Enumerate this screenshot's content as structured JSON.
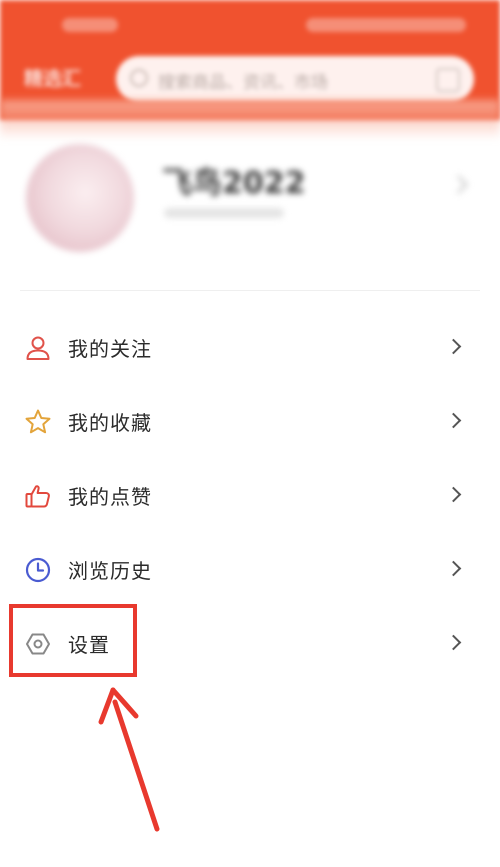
{
  "colors": {
    "header_bg": "#f0522f",
    "annotation_red": "#e8392e",
    "icon_follow": "#e0524a",
    "icon_favorite": "#e3a43a",
    "icon_like": "#e2483d",
    "icon_history": "#4a5bd1",
    "icon_settings": "#888888"
  },
  "header": {
    "title": "精选汇",
    "search_placeholder": "搜索商品、资讯、市场"
  },
  "profile": {
    "username": "飞鸟2022"
  },
  "menu": {
    "items": [
      {
        "label": "我的关注",
        "icon": "user-icon"
      },
      {
        "label": "我的收藏",
        "icon": "star-icon"
      },
      {
        "label": "我的点赞",
        "icon": "thumbs-up-icon"
      },
      {
        "label": "浏览历史",
        "icon": "clock-icon"
      },
      {
        "label": "设置",
        "icon": "settings-icon"
      }
    ]
  }
}
